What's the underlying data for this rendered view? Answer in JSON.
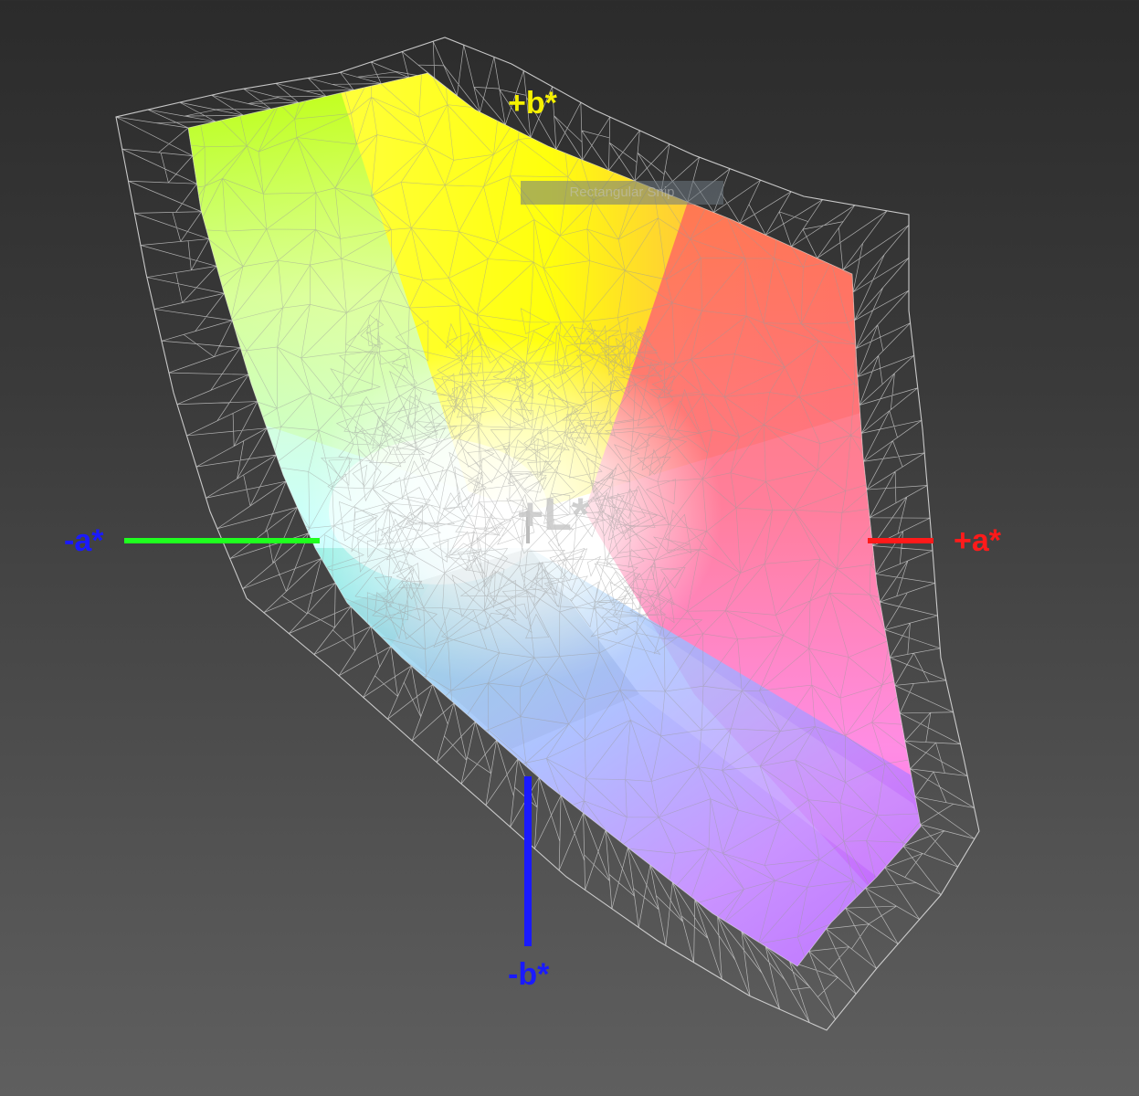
{
  "axes": {
    "minus_a": {
      "label": "-a*",
      "color": "#1a1aff",
      "line_color": "#1fff1f"
    },
    "plus_a": {
      "label": "+a*",
      "color": "#ff1a1a",
      "line_color": "#ff1a1a"
    },
    "plus_b": {
      "label": "+b*",
      "color": "#f5f000",
      "line_color": "#f5f000"
    },
    "minus_b": {
      "label": "-b*",
      "color": "#1a1aff",
      "line_color": "#1a1aff"
    },
    "plus_l": {
      "label": "+L*",
      "color": "#c8c8c8"
    }
  },
  "overlay": {
    "text": "Rectangular Snip"
  },
  "colors": {
    "background_top": "#2b2b2b",
    "background_bottom": "#5f5f5f",
    "wireframe": "#d8d8d8",
    "gamut_yellow": "#ffff00",
    "gamut_green": "#b3ff00",
    "gamut_orange": "#ff8040",
    "gamut_red": "#ff6070",
    "gamut_magenta": "#ff60ff",
    "gamut_purple": "#b060ff",
    "gamut_cyan": "#80ffff",
    "gamut_white": "#ffffff"
  }
}
